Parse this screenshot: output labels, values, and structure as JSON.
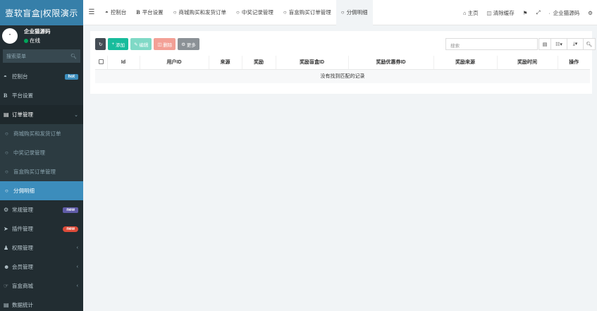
{
  "app": {
    "title": "壹软盲盒|权限演示"
  },
  "user": {
    "avatar_text": "\"",
    "name": "企业猫源码",
    "status": "在线"
  },
  "sidebar": {
    "search_placeholder": "搜索菜单",
    "items": [
      {
        "label": "控制台",
        "icon": "dashboard-icon",
        "badge": "hot"
      },
      {
        "label": "平台设置",
        "icon": "bold-b-icon"
      },
      {
        "label": "订单管理",
        "icon": "list-icon"
      }
    ],
    "submenu": [
      {
        "label": "商城购买和发货订单"
      },
      {
        "label": "中奖记录管理"
      },
      {
        "label": "盲盒购买订单管理"
      },
      {
        "label": "分佣明细"
      }
    ],
    "items2": [
      {
        "label": "常规管理",
        "badge": "new"
      },
      {
        "label": "插件管理",
        "badge": "new"
      },
      {
        "label": "权限管理"
      },
      {
        "label": "会员管理"
      },
      {
        "label": "盲盒商城"
      },
      {
        "label": "数据统计"
      }
    ]
  },
  "topbar": {
    "tabs": [
      {
        "label": "控制台",
        "icon": "dashboard-icon"
      },
      {
        "label": "平台设置",
        "icon": "bold-b-icon"
      },
      {
        "label": "商城购买和发货订单",
        "icon": "circle-icon"
      },
      {
        "label": "中奖记录管理",
        "icon": "circle-icon"
      },
      {
        "label": "盲盒购买订单管理",
        "icon": "circle-icon"
      },
      {
        "label": "分佣明细",
        "icon": "circle-icon"
      }
    ],
    "right": {
      "home": "主页",
      "clear_cache": "清除缓存",
      "user": "企业猫源码"
    }
  },
  "toolbar": {
    "add": "添加",
    "edit": "编辑",
    "delete": "删除",
    "more": "更多",
    "search_placeholder": "搜索"
  },
  "table": {
    "columns": [
      "Id",
      "用户ID",
      "来源",
      "奖励",
      "奖励盲盒ID",
      "奖励优惠券ID",
      "奖励来源",
      "奖励时间",
      "操作"
    ],
    "empty_text": "没有找到匹配的记录"
  },
  "colors": {
    "sidebar_bg": "#222d32",
    "logo_bg": "#367fa9",
    "active_bg": "#3c8dbc",
    "green": "#18bc9c"
  }
}
